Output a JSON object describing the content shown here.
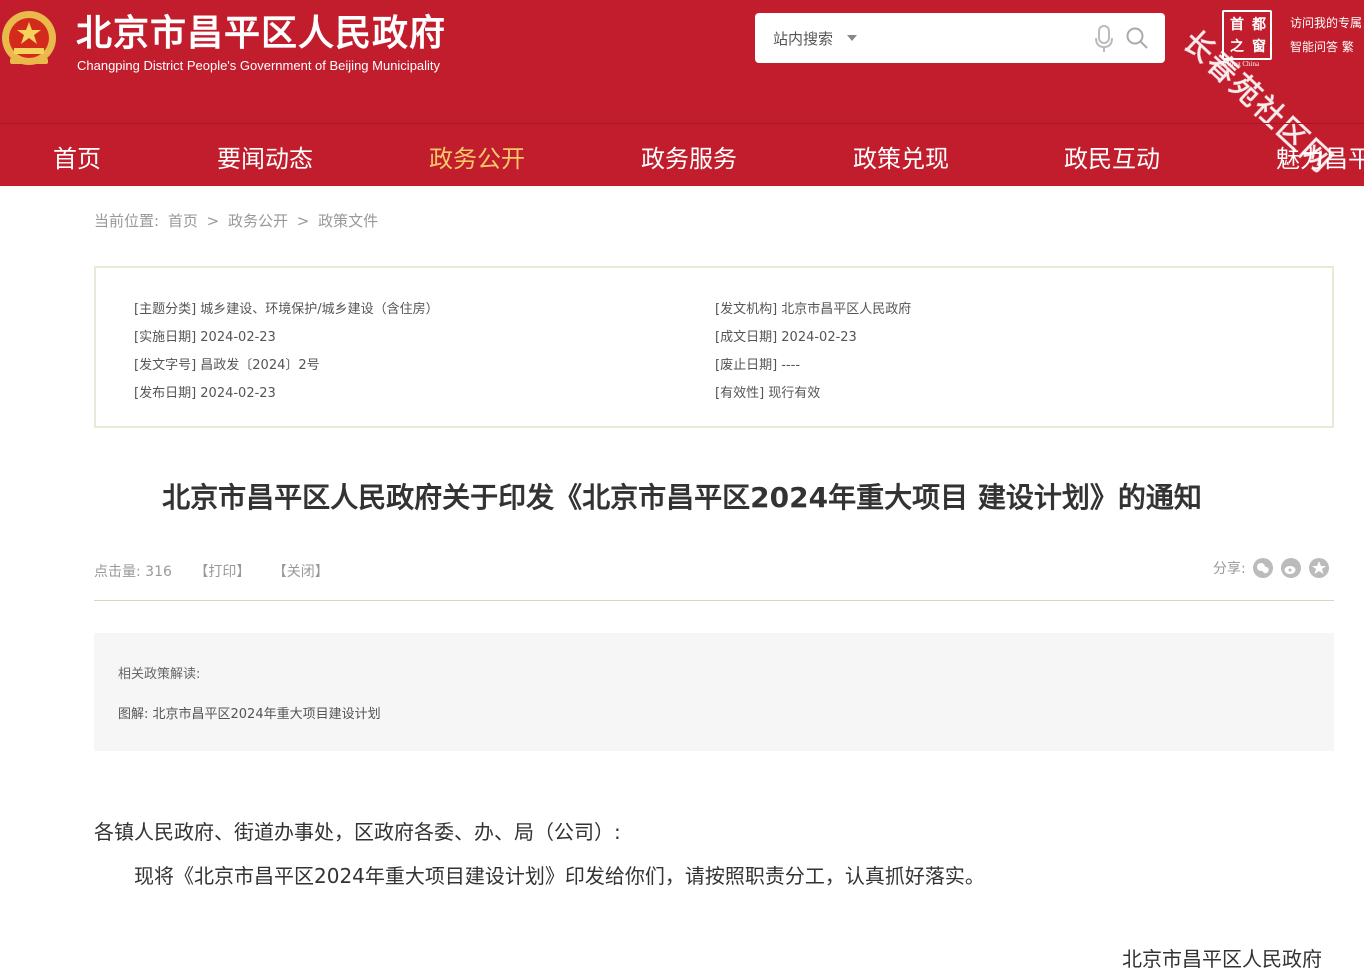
{
  "header": {
    "title": "北京市昌平区人民政府",
    "subtitle": "Changping District People's Government of Beijing Municipality",
    "search": {
      "scope": "站内搜索"
    },
    "badge": {
      "ch1": "首",
      "ch2": "都",
      "ch3": "之",
      "ch4": "窗",
      "en": "Beijing China"
    },
    "links": [
      "访问我的专属",
      "智能问答  繁"
    ],
    "watermark": "长春苑社区网"
  },
  "nav": [
    "首页",
    "要闻动态",
    "政务公开",
    "政务服务",
    "政策兑现",
    "政民互动",
    "魅力昌平"
  ],
  "nav_active_index": 2,
  "breadcrumb": {
    "prefix": "当前位置:",
    "items": [
      "首页",
      "政务公开",
      "政策文件"
    ],
    "sep": ">"
  },
  "meta": {
    "left": [
      "[主题分类] 城乡建设、环境保护/城乡建设（含住房）",
      "[实施日期] 2024-02-23",
      "[发文字号] 昌政发〔2024〕2号",
      "[发布日期] 2024-02-23"
    ],
    "right": [
      "[发文机构] 北京市昌平区人民政府",
      "[成文日期] 2024-02-23",
      "[废止日期] ----",
      "[有效性] 现行有效"
    ]
  },
  "article": {
    "title": "北京市昌平区人民政府关于印发《北京市昌平区2024年重大项目 建设计划》的通知",
    "hits": "点击量: 316",
    "print": "【打印】",
    "close": "【关闭】",
    "share": "分享:"
  },
  "related": {
    "heading": "相关政策解读:",
    "link": "图解: 北京市昌平区2024年重大项目建设计划"
  },
  "body": {
    "salutation": "各镇人民政府、街道办事处，区政府各委、办、局（公司）:",
    "para": "　　现将《北京市昌平区2024年重大项目建设计划》印发给你们，请按照职责分工，认真抓好落实。",
    "signature": "北京市昌平区人民政府"
  }
}
